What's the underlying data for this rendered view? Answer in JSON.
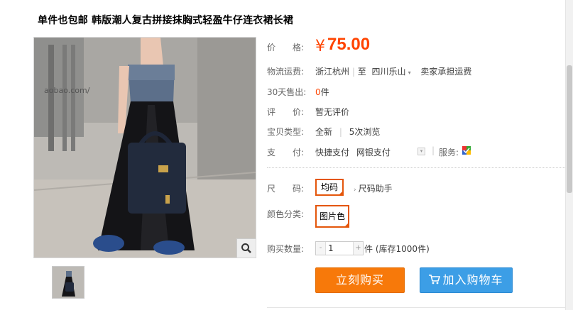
{
  "title": "单件也包邮 韩版潮人复古拼接抹胸式轻盈牛仔连衣裙长裙",
  "gallery": {
    "watermark": "aobao.com/"
  },
  "price": {
    "label": "价　　格:",
    "currency": "¥",
    "value": "75.00"
  },
  "shipping": {
    "label": "物流运费:",
    "from": "浙江杭州",
    "to_sep": "至",
    "to": "四川乐山",
    "fee": "卖家承担运费"
  },
  "sold": {
    "label": "30天售出:",
    "count": "0",
    "unit": "件"
  },
  "review": {
    "label": "评　　价:",
    "value": "暂无评价"
  },
  "item_type": {
    "label": "宝贝类型:",
    "condition": "全新",
    "views": "5次浏览"
  },
  "payment": {
    "label": "支　　付:",
    "method1": "快捷支付",
    "method2": "网银支付",
    "service_label": "服务:"
  },
  "size": {
    "label": "尺　　码:",
    "option": "均码",
    "helper": "尺码助手"
  },
  "color": {
    "label": "颜色分类:",
    "option": "图片色"
  },
  "quantity": {
    "label": "购买数量:",
    "minus": "-",
    "value": "1",
    "plus": "+",
    "unit": "件",
    "stock": "(库存1000件)"
  },
  "buttons": {
    "buy": "立刻购买",
    "cart": "加入购物车"
  },
  "colors": {
    "accent": "#ff4400",
    "buy": "#f7790a",
    "cart": "#3c9ee6",
    "option_border": "#e4560b"
  }
}
